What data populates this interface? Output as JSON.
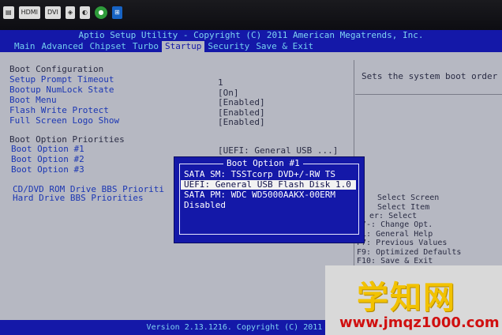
{
  "osd": {
    "icons": [
      "input-source",
      "hdmi",
      "dvi",
      "mode",
      "color",
      "power-green",
      "windows-logo"
    ],
    "hdmi_label": "HDMI",
    "dvi_label": "DVI"
  },
  "bios": {
    "title": "Aptio Setup Utility - Copyright (C) 2011 American Megatrends, Inc.",
    "tabs": [
      {
        "label": "Main",
        "active": false
      },
      {
        "label": "Advanced",
        "active": false
      },
      {
        "label": "Chipset",
        "active": false
      },
      {
        "label": "Turbo",
        "active": false
      },
      {
        "label": "Startup",
        "active": true
      },
      {
        "label": "Security",
        "active": false
      },
      {
        "label": "Save & Exit",
        "active": false
      }
    ],
    "settings": {
      "boot_config_header": "Boot Configuration",
      "setup_prompt_timeout": {
        "label": "Setup Prompt Timeout",
        "value": "1"
      },
      "bootup_numlock_state": {
        "label": "Bootup NumLock State",
        "value": "[On]"
      },
      "boot_menu": {
        "label": "Boot Menu",
        "value": "[Enabled]"
      },
      "flash_write_protect": {
        "label": "Flash Write Protect",
        "value": "[Enabled]"
      },
      "full_screen_logo_show": {
        "label": "Full Screen Logo Show",
        "value": "[Enabled]"
      },
      "boot_option_priorities_header": "Boot Option Priorities",
      "boot_option_1": {
        "label": "Boot Option #1",
        "value": "[UEFI: General USB ...]"
      },
      "boot_option_2": {
        "label": "Boot Option #2"
      },
      "boot_option_3": {
        "label": "Boot Option #3"
      },
      "cd_dvd_bbs": {
        "label": "CD/DVD ROM Drive BBS Prioriti"
      },
      "hard_drive_bbs": {
        "label": "Hard Drive BBS Priorities"
      }
    },
    "help": {
      "description": "Sets the system boot order",
      "keys": [
        "Select Screen",
        "Select Item",
        "er: Select",
        "+/-: Change Opt.",
        "F1: General Help",
        "F7: Previous Values",
        "F9: Optimized Defaults",
        "F10: Save & Exit"
      ]
    },
    "popup": {
      "title": "Boot Option #1",
      "items": [
        {
          "label": "SATA  SM: TSSTcorp DVD+/-RW TS",
          "selected": false
        },
        {
          "label": "UEFI: General USB Flash Disk 1.0",
          "selected": true
        },
        {
          "label": "SATA  PM: WDC WD5000AAKX-00ERM",
          "selected": false
        },
        {
          "label": "Disabled",
          "selected": false
        }
      ]
    },
    "footer": "Version 2.13.1216. Copyright (C) 2011 Americ"
  },
  "watermark": {
    "logo": "学知网",
    "url": "www.jmqz1000.com"
  }
}
